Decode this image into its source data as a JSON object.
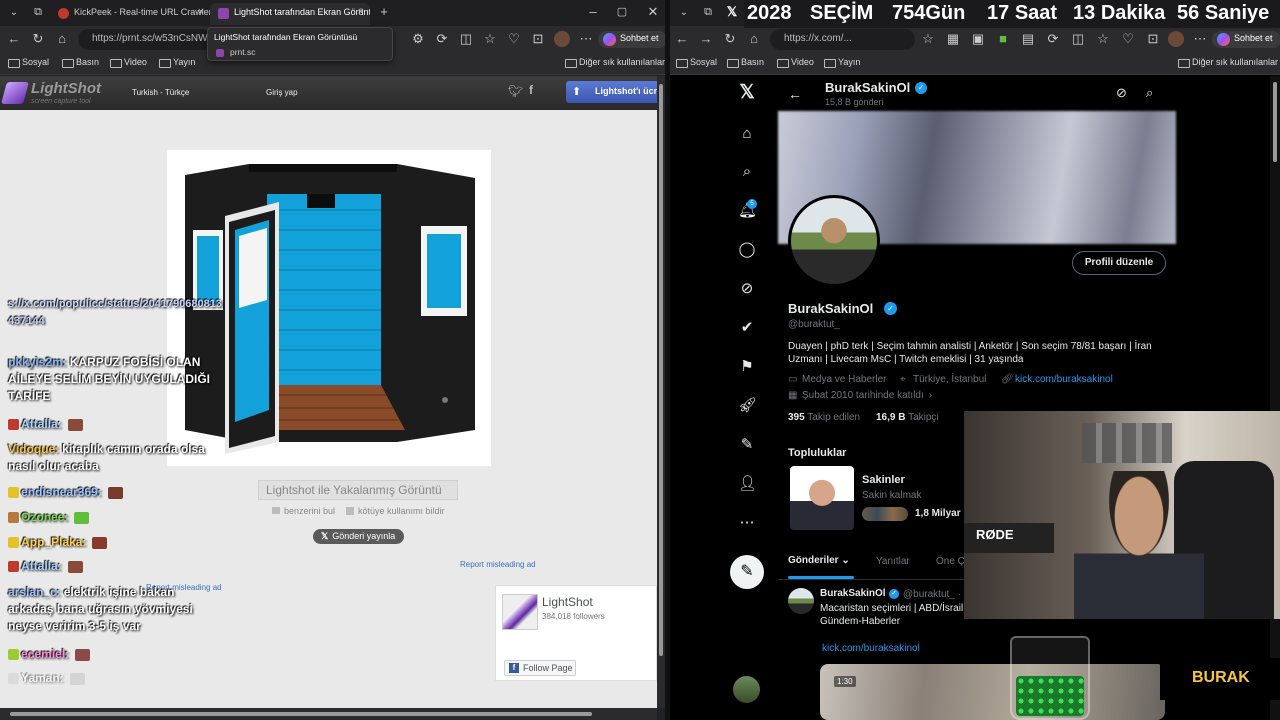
{
  "left_window": {
    "tabs": [
      {
        "title": "KickPeek - Real-time URL Crawler"
      },
      {
        "title": "LightShot tarafından Ekran Görüntüsü"
      }
    ],
    "tooltip": {
      "title": "LightShot tarafından Ekran Görüntüsü",
      "domain": "prnt.sc"
    },
    "url": "https://prnt.sc/w53nCsNW",
    "bookmarks": [
      "Sosyal",
      "Basın",
      "Video",
      "Yayın"
    ],
    "other_bookmarks": "Diğer sık kullanılanlar",
    "sohbet_label": "Sohbet et"
  },
  "lightshot": {
    "logo": "LightShot",
    "logo_sub": "screen capture tool",
    "language": "Turkish - Türkçe",
    "login": "Giriş yap",
    "promo": "Lightshot'ı ücretsiz",
    "caption": "Lightshot ile Yakalanmış Görüntü",
    "find_similar": "benzerini bul",
    "report_abuse": "kötüye kullanımı bildir",
    "post_button": "Gönderi yayınla",
    "report_ad_1": "Report misleading ad",
    "report_ad_2": "Report misleading ad",
    "fb_widget": {
      "name": "LightShot",
      "followers": "384,018 followers",
      "follow_label": "Follow Page"
    }
  },
  "chat": {
    "lines": [
      {
        "user": "",
        "text": "s://x.com/populicc/status/2041790680813437144",
        "user_color": "#a0c4ff"
      },
      {
        "user": "pkkyis2m:",
        "text": "KARPUZ FOBİSİ OLAN AİLEYE SELİM BEYİN UYGULADIĞI TARİFE",
        "user_color": "#8ab4f8"
      },
      {
        "user": "Attalla:",
        "text": "",
        "user_color": "#a8d4ff"
      },
      {
        "user": "Vidoque:",
        "text": "kitaplık camın orada olsa nasıl olur acaba",
        "user_color": "#f5c542"
      },
      {
        "user": "endisnear369:",
        "text": "",
        "user_color": "#9ec3ff"
      },
      {
        "user": "Ozonee:",
        "text": "",
        "user_color": "#7fd858"
      },
      {
        "user": "App_Plaka:",
        "text": "",
        "user_color": "#ffd34d"
      },
      {
        "user": "Attalla:",
        "text": "",
        "user_color": "#a8d4ff"
      },
      {
        "user": "arslan_c:",
        "text": "elektrik işine bakan arkadaş bana uğrasın yövmiyesi neyse veririm 3-5 iş var",
        "user_color": "#9ec3ff"
      },
      {
        "user": "ecemiel:",
        "text": "",
        "user_color": "#ff8ad8"
      },
      {
        "user": "Yaman:",
        "text": "",
        "user_color": "#ffffff"
      }
    ]
  },
  "overlay": {
    "year": "2028",
    "label": "SEÇİM",
    "days": "754",
    "days_unit": "Gün",
    "hours": "17",
    "hours_unit": "Saat",
    "minutes": "13",
    "minutes_unit": "Dakika",
    "seconds": "56",
    "seconds_unit": "Saniye",
    "streamer_name": "BURAK"
  },
  "right_window": {
    "url": "https://x.com/...",
    "bookmarks": [
      "Sosyal",
      "Basın",
      "Video",
      "Yayın"
    ],
    "other_bookmarks": "Diğer sık kullanılanlar",
    "sohbet_label": "Sohbet et"
  },
  "x_profile": {
    "header_name": "BurakSakinOl",
    "header_posts": "15,8 B gönderi",
    "display_name": "BurakSakinOl",
    "handle": "@buraktut_",
    "edit_button": "Profili düzenle",
    "bio": "Duayen | phD terk | Seçim tahmin analisti | Anketör | Son seçim 78/81 başarı | İran Uzmanı | Livecam MsC | Twitch emeklisi | 31 yaşında",
    "category": "Medya ve Haberler",
    "location": "Türkiye, İstanbul",
    "link": "kick.com/buraksakinol",
    "joined": "Şubat 2010 tarihinde katıldı",
    "following_count": "395",
    "following_label": "Takip edilen",
    "followers_count": "16,9 B",
    "followers_label": "Takipçi",
    "communities_title": "Topluluklar",
    "community": {
      "name": "Sakinler",
      "subtitle": "Sakin kalmak",
      "members": "1,8 Milyar"
    },
    "tabs": [
      "Gönderiler",
      "Yanıtlar",
      "Öne Çı"
    ],
    "post": {
      "author": "BurakSakinOl",
      "handle": "@buraktut_ ·",
      "text_line1": "Macaristan seçimleri | ABD/İsrail",
      "text_line2": "Gündem-Haberler",
      "link": "kick.com/buraksakinol",
      "video_time": "1:30"
    },
    "notif_count": "5"
  },
  "webcam": {
    "mic_brand": "RØDE"
  }
}
